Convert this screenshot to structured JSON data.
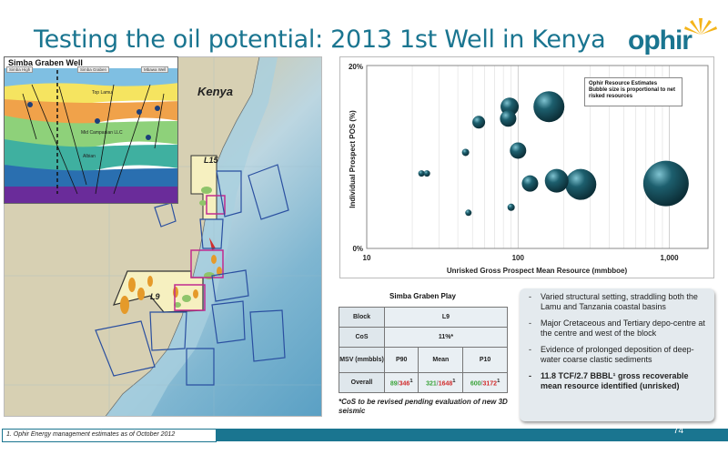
{
  "slide": {
    "title": "Testing the oil potential: 2013 1st Well in Kenya",
    "page_number": "74",
    "footnote": "1. Ophir Energy management estimates as of October 2012"
  },
  "logo": {
    "text": "ophir",
    "color": "#1a7590"
  },
  "map": {
    "country_label": "Kenya",
    "blocks": [
      "L15",
      "L9"
    ],
    "inset": {
      "title": "Simba Graben Well",
      "well_heads": [
        "Simba High",
        "Simba Graben",
        "Mbawa Well"
      ],
      "horizons": [
        "Top Lamu",
        "Mid Campanian LLC",
        "Albian"
      ]
    }
  },
  "chart_data": {
    "type": "scatter",
    "xlabel": "Unrisked Gross Prospect Mean Resource (mmbboe)",
    "ylabel": "Individual Prospect POS (%)",
    "xscale": "log",
    "xlim": [
      10,
      1800
    ],
    "ylim": [
      0,
      20
    ],
    "x_ticks": [
      "10",
      "100",
      "1,000"
    ],
    "y_ticks": [
      "20%",
      "0%"
    ],
    "legend_lines": [
      "Ophir Resource Estimates",
      "Bubble size is proportional to net",
      "risked resources"
    ],
    "legend_position": "top-right",
    "bubble_color": "#1d5f6e",
    "points": [
      {
        "x": 23,
        "y": 8.2,
        "size": 3
      },
      {
        "x": 25,
        "y": 8.2,
        "size": 3
      },
      {
        "x": 45,
        "y": 10.5,
        "size": 4
      },
      {
        "x": 47,
        "y": 3.9,
        "size": 2
      },
      {
        "x": 55,
        "y": 13.8,
        "size": 7
      },
      {
        "x": 86,
        "y": 14.2,
        "size": 9
      },
      {
        "x": 88,
        "y": 15.5,
        "size": 10
      },
      {
        "x": 90,
        "y": 4.5,
        "size": 4
      },
      {
        "x": 100,
        "y": 10.7,
        "size": 9
      },
      {
        "x": 120,
        "y": 7.1,
        "size": 9
      },
      {
        "x": 160,
        "y": 15.5,
        "size": 17
      },
      {
        "x": 180,
        "y": 7.4,
        "size": 13
      },
      {
        "x": 260,
        "y": 7.0,
        "size": 17
      },
      {
        "x": 950,
        "y": 7.1,
        "size": 25
      }
    ]
  },
  "play_table": {
    "title": "Simba Graben Play",
    "rows": {
      "block_label": "Block",
      "block_value": "L9",
      "cos_label": "CoS",
      "cos_value": "11%*",
      "msv_label": "MSV (mmbbls)",
      "p90_header": "P90",
      "mean_header": "Mean",
      "p10_header": "P10",
      "overall_label": "Overall",
      "p90": "89",
      "p90_b": "346",
      "mean": "321",
      "mean_b": "1648",
      "p10": "600",
      "p10_b": "3172"
    },
    "note": "*CoS to be revised pending evaluation of new 3D seismic"
  },
  "bullets": [
    "Varied structural setting, straddling both the Lamu and Tanzania coastal basins",
    "Major Cretaceous and Tertiary depo-centre at the centre and west of the block",
    "Evidence of prolonged deposition of deep-water coarse clastic sediments",
    "11.8 TCF/2.7 BBBL¹ gross recoverable mean resource identified (unrisked)"
  ]
}
